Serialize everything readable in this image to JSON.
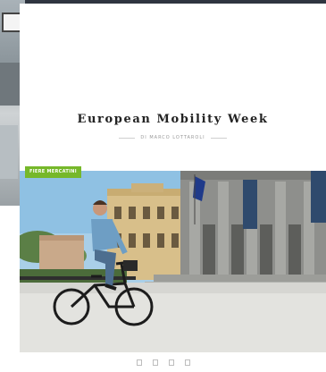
{
  "post": {
    "category": "FIERE MERCATINI",
    "title": "European Mobility Week",
    "byline": "DI MARCO LOTTAROLI"
  },
  "pager": {
    "dots": 4
  },
  "colors": {
    "badge": "#76b82a",
    "title": "#222222",
    "byline": "#9a9a9a"
  }
}
